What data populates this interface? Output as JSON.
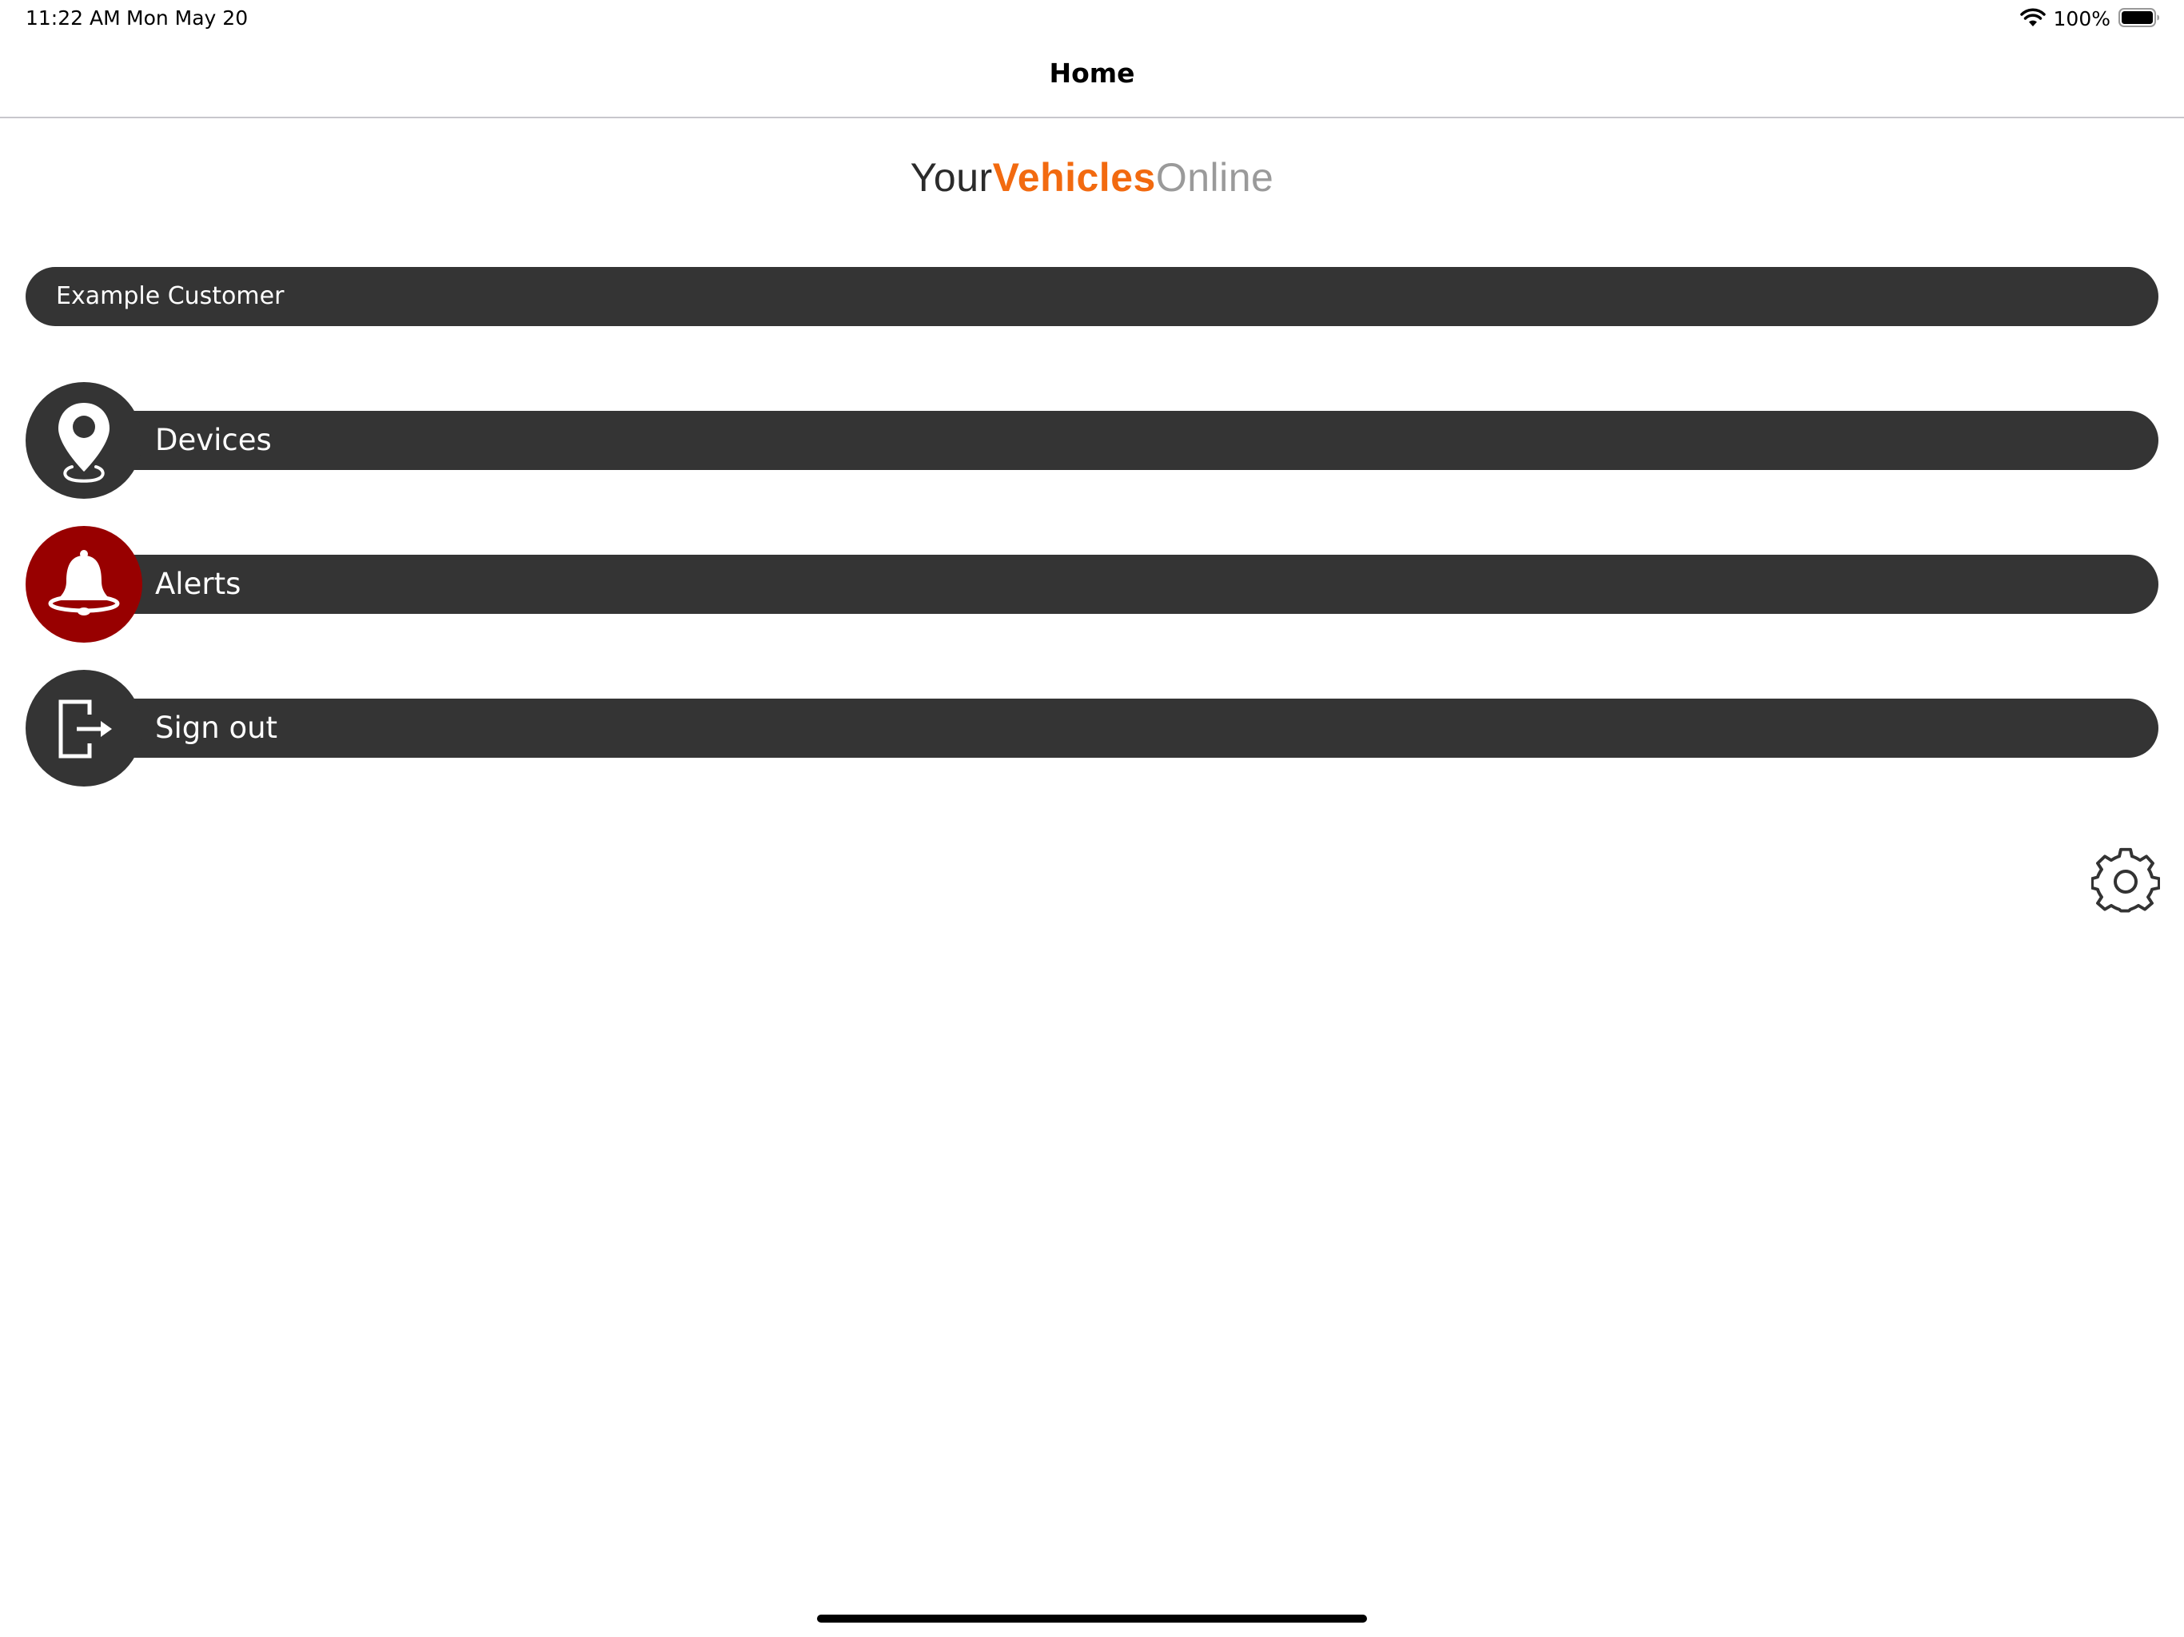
{
  "status_bar": {
    "time": "11:22 AM",
    "date": "Mon May 20",
    "battery_percent": "100%",
    "icons": [
      "wifi-icon",
      "battery-icon"
    ]
  },
  "nav": {
    "title": "Home"
  },
  "logo": {
    "part_your": "Your",
    "part_vehicles": "Vehicles",
    "part_online": "Online"
  },
  "customer": {
    "name": "Example Customer"
  },
  "menu": {
    "items": [
      {
        "label": "Devices",
        "icon": "map-pin-icon"
      },
      {
        "label": "Alerts",
        "icon": "bell-icon"
      },
      {
        "label": "Sign out",
        "icon": "sign-out-icon"
      }
    ]
  },
  "settings": {
    "icon": "gear-icon"
  },
  "colors": {
    "bar": "#343434",
    "alert": "#980000",
    "brand_orange": "#f26a10",
    "brand_gray": "#9a9a9a",
    "divider": "#c8c7cc"
  }
}
